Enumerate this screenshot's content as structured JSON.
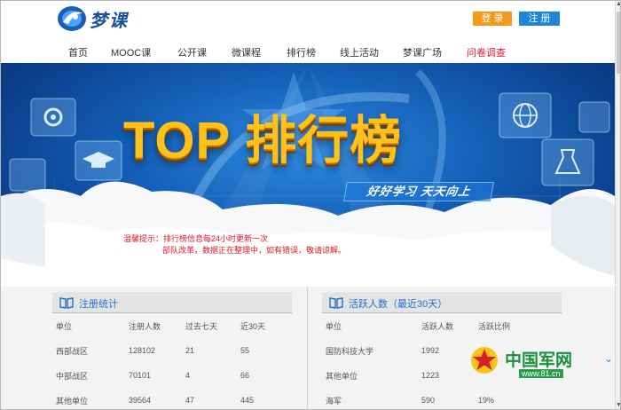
{
  "brand": {
    "name": "梦课"
  },
  "header": {
    "login_label": "登 录",
    "register_label": "注 册"
  },
  "nav": [
    {
      "label": "首页",
      "highlight": false
    },
    {
      "label": "MOOC课",
      "highlight": false
    },
    {
      "label": "公开课",
      "highlight": false
    },
    {
      "label": "微课程",
      "highlight": false
    },
    {
      "label": "排行榜",
      "highlight": false
    },
    {
      "label": "线上活动",
      "highlight": false
    },
    {
      "label": "梦课广场",
      "highlight": false
    },
    {
      "label": "问卷调查",
      "highlight": true
    }
  ],
  "banner": {
    "title": "TOP 排行榜",
    "slogan": "好好学习 天天向上",
    "notice_line1": "温馨提示：排行榜信息每24小时更新一次",
    "notice_line2": "部队改革，数据正在整理中，如有错误，敬请谅解。"
  },
  "registration_panel": {
    "title": "注册统计",
    "headers": [
      "单位",
      "注册人数",
      "过去七天",
      "近30天"
    ],
    "rows": [
      [
        "西部战区",
        "128102",
        "21",
        "55"
      ],
      [
        "中部战区",
        "70101",
        "4",
        "66"
      ],
      [
        "其他单位",
        "39564",
        "47",
        "445"
      ]
    ]
  },
  "active_panel": {
    "title": "活跃人数（最近30天）",
    "headers": [
      "单位",
      "活跃人数",
      "活跃比例"
    ],
    "rows": [
      [
        "国防科技大学",
        "1992",
        ""
      ],
      [
        "其他单位",
        "1223",
        ""
      ],
      [
        "海军",
        "590",
        "19%"
      ]
    ]
  },
  "watermark": {
    "text": "中国军网",
    "url": "www.81.cn"
  },
  "colors": {
    "accent_blue": "#1d86d8",
    "accent_orange": "#f39a1b",
    "alert_red": "#e0182a",
    "title_gold": "#ffc21a"
  }
}
